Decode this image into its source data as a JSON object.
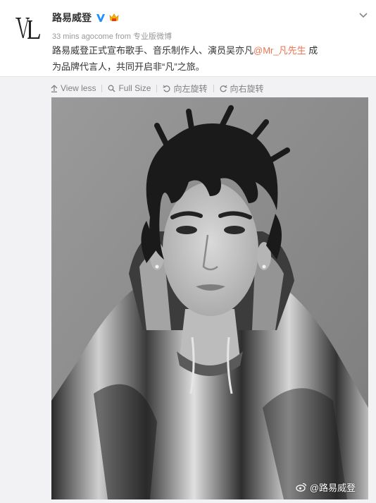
{
  "post": {
    "username": "路易威登",
    "time_text": "33 mins ago",
    "source_prefix": "come from",
    "source_name": "专业版微博",
    "content_before": "路易威登正式宣布歌手、音乐制作人、演员吴亦凡",
    "mention": "@Mr_凡先生",
    "content_after": " 成为品牌代言人，共同开启非“凡”之旅。"
  },
  "toolbar": {
    "view_less": "View less",
    "full_size": "Full Size",
    "rotate_left": "向左旋转",
    "rotate_right": "向右旋转"
  },
  "photo": {
    "watermark_text": "@路易威登"
  },
  "colors": {
    "mention": "#eb7350",
    "verified": "#1e90ff",
    "badge": "#f7b500",
    "meta": "#999999",
    "toolbar_bg": "#f2f2f5"
  },
  "icons": {
    "avatar": "lv-logo",
    "verified": "verified-v-icon",
    "badge": "member-badge-icon",
    "dropdown": "chevron-down-icon",
    "view_less": "arrow-up-icon",
    "full_size": "magnifier-icon",
    "rotate_left": "rotate-left-icon",
    "rotate_right": "rotate-right-icon",
    "watermark": "weibo-icon"
  }
}
